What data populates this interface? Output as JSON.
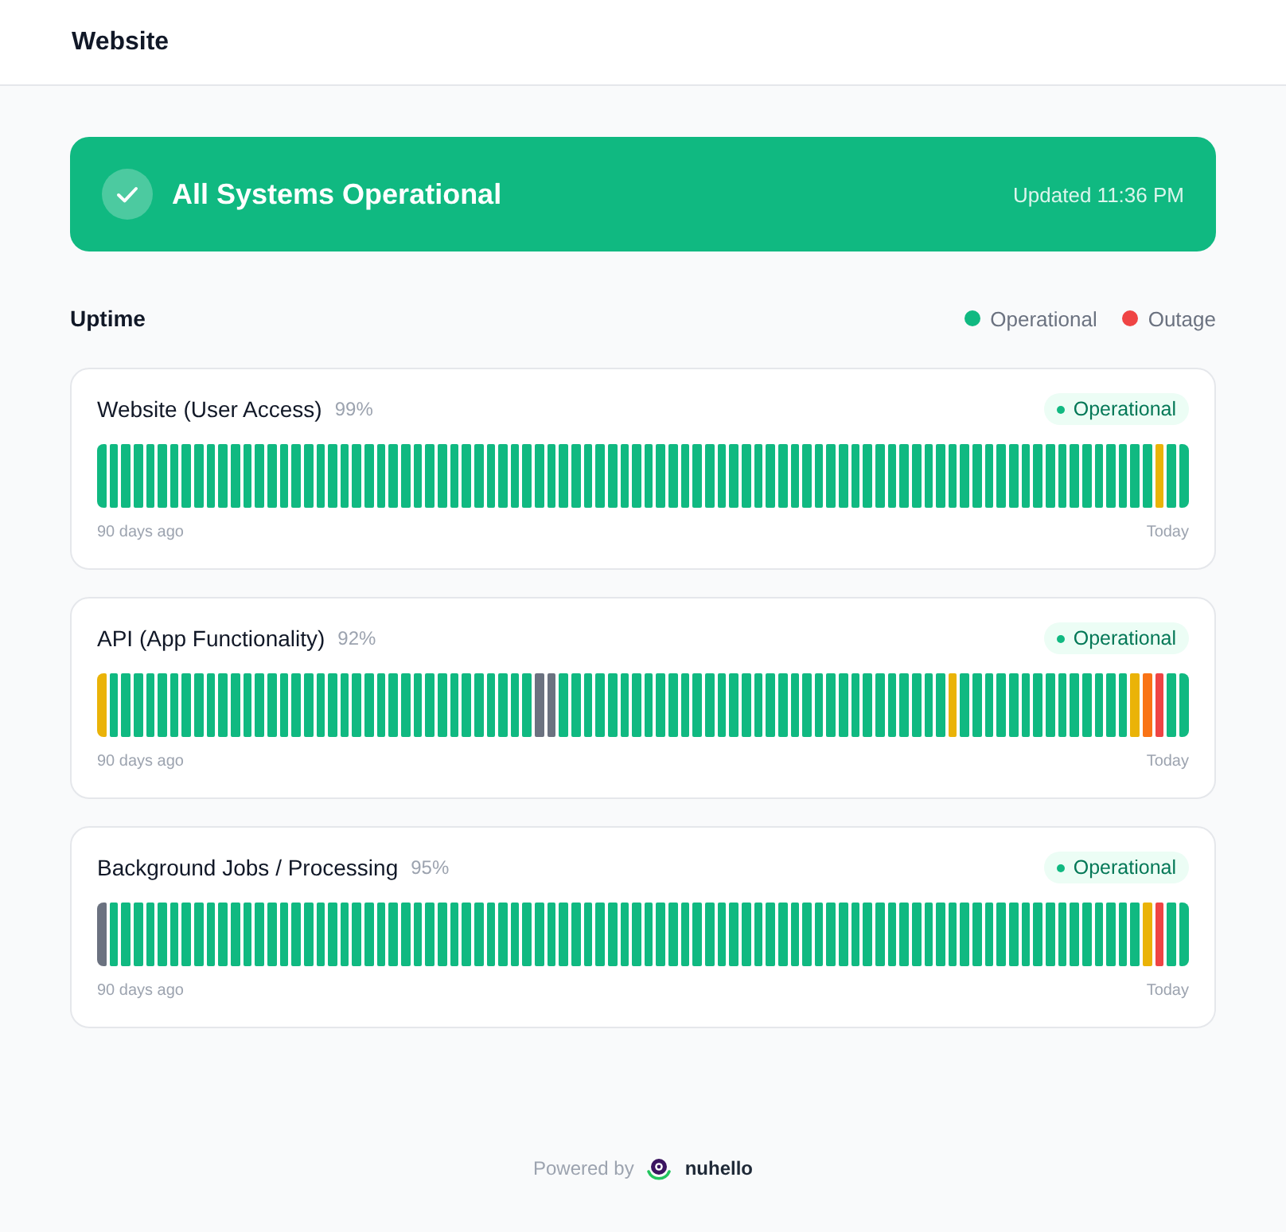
{
  "header": {
    "title": "Website"
  },
  "banner": {
    "status": "All Systems Operational",
    "updated": "Updated 11:36 PM"
  },
  "uptime": {
    "title": "Uptime",
    "legend": [
      {
        "label": "Operational",
        "color": "#10b981"
      },
      {
        "label": "Outage",
        "color": "#ef4444"
      }
    ]
  },
  "services": [
    {
      "name": "Website (User Access)",
      "uptime": "99%",
      "status": "Operational",
      "range_start": "90 days ago",
      "range_end": "Today",
      "days": [
        {
          "color": "#10b981"
        },
        {
          "color": "#10b981"
        },
        {
          "color": "#10b981"
        },
        {
          "color": "#10b981"
        },
        {
          "color": "#10b981"
        },
        {
          "color": "#10b981"
        },
        {
          "color": "#10b981"
        },
        {
          "color": "#10b981"
        },
        {
          "color": "#10b981"
        },
        {
          "color": "#10b981"
        },
        {
          "color": "#10b981"
        },
        {
          "color": "#10b981"
        },
        {
          "color": "#10b981"
        },
        {
          "color": "#10b981"
        },
        {
          "color": "#10b981"
        },
        {
          "color": "#10b981"
        },
        {
          "color": "#10b981"
        },
        {
          "color": "#10b981"
        },
        {
          "color": "#10b981"
        },
        {
          "color": "#10b981"
        },
        {
          "color": "#10b981"
        },
        {
          "color": "#10b981"
        },
        {
          "color": "#10b981"
        },
        {
          "color": "#10b981"
        },
        {
          "color": "#10b981"
        },
        {
          "color": "#10b981"
        },
        {
          "color": "#10b981"
        },
        {
          "color": "#10b981"
        },
        {
          "color": "#10b981"
        },
        {
          "color": "#10b981"
        },
        {
          "color": "#10b981"
        },
        {
          "color": "#10b981"
        },
        {
          "color": "#10b981"
        },
        {
          "color": "#10b981"
        },
        {
          "color": "#10b981"
        },
        {
          "color": "#10b981"
        },
        {
          "color": "#10b981"
        },
        {
          "color": "#10b981"
        },
        {
          "color": "#10b981"
        },
        {
          "color": "#10b981"
        },
        {
          "color": "#10b981"
        },
        {
          "color": "#10b981"
        },
        {
          "color": "#10b981"
        },
        {
          "color": "#10b981"
        },
        {
          "color": "#10b981"
        },
        {
          "color": "#10b981"
        },
        {
          "color": "#10b981"
        },
        {
          "color": "#10b981"
        },
        {
          "color": "#10b981"
        },
        {
          "color": "#10b981"
        },
        {
          "color": "#10b981"
        },
        {
          "color": "#10b981"
        },
        {
          "color": "#10b981"
        },
        {
          "color": "#10b981"
        },
        {
          "color": "#10b981"
        },
        {
          "color": "#10b981"
        },
        {
          "color": "#10b981"
        },
        {
          "color": "#10b981"
        },
        {
          "color": "#10b981"
        },
        {
          "color": "#10b981"
        },
        {
          "color": "#10b981"
        },
        {
          "color": "#10b981"
        },
        {
          "color": "#10b981"
        },
        {
          "color": "#10b981"
        },
        {
          "color": "#10b981"
        },
        {
          "color": "#10b981"
        },
        {
          "color": "#10b981"
        },
        {
          "color": "#10b981"
        },
        {
          "color": "#10b981"
        },
        {
          "color": "#10b981"
        },
        {
          "color": "#10b981"
        },
        {
          "color": "#10b981"
        },
        {
          "color": "#10b981"
        },
        {
          "color": "#10b981"
        },
        {
          "color": "#10b981"
        },
        {
          "color": "#10b981"
        },
        {
          "color": "#10b981"
        },
        {
          "color": "#10b981"
        },
        {
          "color": "#10b981"
        },
        {
          "color": "#10b981"
        },
        {
          "color": "#10b981"
        },
        {
          "color": "#10b981"
        },
        {
          "color": "#10b981"
        },
        {
          "color": "#10b981"
        },
        {
          "color": "#10b981"
        },
        {
          "color": "#10b981"
        },
        {
          "color": "#10b981"
        },
        {
          "color": "#eab308"
        },
        {
          "color": "#10b981"
        },
        {
          "color": "#10b981"
        }
      ]
    },
    {
      "name": "API (App Functionality)",
      "uptime": "92%",
      "status": "Operational",
      "range_start": "90 days ago",
      "range_end": "Today",
      "days": [
        {
          "color": "#eab308"
        },
        {
          "color": "#10b981"
        },
        {
          "color": "#10b981"
        },
        {
          "color": "#10b981"
        },
        {
          "color": "#10b981"
        },
        {
          "color": "#10b981"
        },
        {
          "color": "#10b981"
        },
        {
          "color": "#10b981"
        },
        {
          "color": "#10b981"
        },
        {
          "color": "#10b981"
        },
        {
          "color": "#10b981"
        },
        {
          "color": "#10b981"
        },
        {
          "color": "#10b981"
        },
        {
          "color": "#10b981"
        },
        {
          "color": "#10b981"
        },
        {
          "color": "#10b981"
        },
        {
          "color": "#10b981"
        },
        {
          "color": "#10b981"
        },
        {
          "color": "#10b981"
        },
        {
          "color": "#10b981"
        },
        {
          "color": "#10b981"
        },
        {
          "color": "#10b981"
        },
        {
          "color": "#10b981"
        },
        {
          "color": "#10b981"
        },
        {
          "color": "#10b981"
        },
        {
          "color": "#10b981"
        },
        {
          "color": "#10b981"
        },
        {
          "color": "#10b981"
        },
        {
          "color": "#10b981"
        },
        {
          "color": "#10b981"
        },
        {
          "color": "#10b981"
        },
        {
          "color": "#10b981"
        },
        {
          "color": "#10b981"
        },
        {
          "color": "#10b981"
        },
        {
          "color": "#10b981"
        },
        {
          "color": "#10b981"
        },
        {
          "color": "#6b7280"
        },
        {
          "color": "#6b7280"
        },
        {
          "color": "#10b981"
        },
        {
          "color": "#10b981"
        },
        {
          "color": "#10b981"
        },
        {
          "color": "#10b981"
        },
        {
          "color": "#10b981"
        },
        {
          "color": "#10b981"
        },
        {
          "color": "#10b981"
        },
        {
          "color": "#10b981"
        },
        {
          "color": "#10b981"
        },
        {
          "color": "#10b981"
        },
        {
          "color": "#10b981"
        },
        {
          "color": "#10b981"
        },
        {
          "color": "#10b981"
        },
        {
          "color": "#10b981"
        },
        {
          "color": "#10b981"
        },
        {
          "color": "#10b981"
        },
        {
          "color": "#10b981"
        },
        {
          "color": "#10b981"
        },
        {
          "color": "#10b981"
        },
        {
          "color": "#10b981"
        },
        {
          "color": "#10b981"
        },
        {
          "color": "#10b981"
        },
        {
          "color": "#10b981"
        },
        {
          "color": "#10b981"
        },
        {
          "color": "#10b981"
        },
        {
          "color": "#10b981"
        },
        {
          "color": "#10b981"
        },
        {
          "color": "#10b981"
        },
        {
          "color": "#10b981"
        },
        {
          "color": "#10b981"
        },
        {
          "color": "#10b981"
        },
        {
          "color": "#10b981"
        },
        {
          "color": "#eab308"
        },
        {
          "color": "#10b981"
        },
        {
          "color": "#10b981"
        },
        {
          "color": "#10b981"
        },
        {
          "color": "#10b981"
        },
        {
          "color": "#10b981"
        },
        {
          "color": "#10b981"
        },
        {
          "color": "#10b981"
        },
        {
          "color": "#10b981"
        },
        {
          "color": "#10b981"
        },
        {
          "color": "#10b981"
        },
        {
          "color": "#10b981"
        },
        {
          "color": "#10b981"
        },
        {
          "color": "#10b981"
        },
        {
          "color": "#10b981"
        },
        {
          "color": "#eab308"
        },
        {
          "color": "#f97316"
        },
        {
          "color": "#ef4444"
        },
        {
          "color": "#10b981"
        },
        {
          "color": "#10b981"
        }
      ]
    },
    {
      "name": "Background Jobs / Processing",
      "uptime": "95%",
      "status": "Operational",
      "range_start": "90 days ago",
      "range_end": "Today",
      "days": [
        {
          "color": "#6b7280"
        },
        {
          "color": "#10b981"
        },
        {
          "color": "#10b981"
        },
        {
          "color": "#10b981"
        },
        {
          "color": "#10b981"
        },
        {
          "color": "#10b981"
        },
        {
          "color": "#10b981"
        },
        {
          "color": "#10b981"
        },
        {
          "color": "#10b981"
        },
        {
          "color": "#10b981"
        },
        {
          "color": "#10b981"
        },
        {
          "color": "#10b981"
        },
        {
          "color": "#10b981"
        },
        {
          "color": "#10b981"
        },
        {
          "color": "#10b981"
        },
        {
          "color": "#10b981"
        },
        {
          "color": "#10b981"
        },
        {
          "color": "#10b981"
        },
        {
          "color": "#10b981"
        },
        {
          "color": "#10b981"
        },
        {
          "color": "#10b981"
        },
        {
          "color": "#10b981"
        },
        {
          "color": "#10b981"
        },
        {
          "color": "#10b981"
        },
        {
          "color": "#10b981"
        },
        {
          "color": "#10b981"
        },
        {
          "color": "#10b981"
        },
        {
          "color": "#10b981"
        },
        {
          "color": "#10b981"
        },
        {
          "color": "#10b981"
        },
        {
          "color": "#10b981"
        },
        {
          "color": "#10b981"
        },
        {
          "color": "#10b981"
        },
        {
          "color": "#10b981"
        },
        {
          "color": "#10b981"
        },
        {
          "color": "#10b981"
        },
        {
          "color": "#10b981"
        },
        {
          "color": "#10b981"
        },
        {
          "color": "#10b981"
        },
        {
          "color": "#10b981"
        },
        {
          "color": "#10b981"
        },
        {
          "color": "#10b981"
        },
        {
          "color": "#10b981"
        },
        {
          "color": "#10b981"
        },
        {
          "color": "#10b981"
        },
        {
          "color": "#10b981"
        },
        {
          "color": "#10b981"
        },
        {
          "color": "#10b981"
        },
        {
          "color": "#10b981"
        },
        {
          "color": "#10b981"
        },
        {
          "color": "#10b981"
        },
        {
          "color": "#10b981"
        },
        {
          "color": "#10b981"
        },
        {
          "color": "#10b981"
        },
        {
          "color": "#10b981"
        },
        {
          "color": "#10b981"
        },
        {
          "color": "#10b981"
        },
        {
          "color": "#10b981"
        },
        {
          "color": "#10b981"
        },
        {
          "color": "#10b981"
        },
        {
          "color": "#10b981"
        },
        {
          "color": "#10b981"
        },
        {
          "color": "#10b981"
        },
        {
          "color": "#10b981"
        },
        {
          "color": "#10b981"
        },
        {
          "color": "#10b981"
        },
        {
          "color": "#10b981"
        },
        {
          "color": "#10b981"
        },
        {
          "color": "#10b981"
        },
        {
          "color": "#10b981"
        },
        {
          "color": "#10b981"
        },
        {
          "color": "#10b981"
        },
        {
          "color": "#10b981"
        },
        {
          "color": "#10b981"
        },
        {
          "color": "#10b981"
        },
        {
          "color": "#10b981"
        },
        {
          "color": "#10b981"
        },
        {
          "color": "#10b981"
        },
        {
          "color": "#10b981"
        },
        {
          "color": "#10b981"
        },
        {
          "color": "#10b981"
        },
        {
          "color": "#10b981"
        },
        {
          "color": "#10b981"
        },
        {
          "color": "#10b981"
        },
        {
          "color": "#10b981"
        },
        {
          "color": "#10b981"
        },
        {
          "color": "#eab308"
        },
        {
          "color": "#ef4444"
        },
        {
          "color": "#10b981"
        },
        {
          "color": "#10b981"
        }
      ]
    }
  ],
  "footer": {
    "prefix": "Powered by",
    "brand": "nuhello"
  }
}
